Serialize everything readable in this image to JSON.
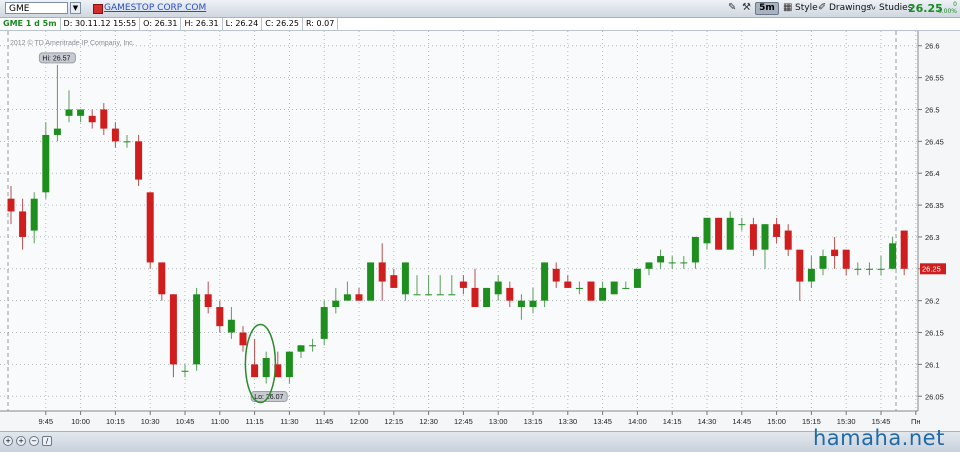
{
  "toolbar": {
    "symbol": "GME",
    "company_link": "GAMESTOP CORP COM",
    "period": "5m",
    "style_label": "Style",
    "drawings_label": "Drawings",
    "studies_label": "Studies",
    "last_price": "26.25",
    "change_abs": "0",
    "change_pct": "0.00%"
  },
  "info_bar": {
    "study": "GME 1 d 5m",
    "date": "D: 30.11.12 15:55",
    "open": "O: 26.31",
    "high": "H: 26.31",
    "low": "L: 26.24",
    "close": "C: 26.25",
    "range": "R: 0.07"
  },
  "chart_data": {
    "type": "candlestick",
    "copyright": "2012 © TD Ameritrade IP Company, Inc.",
    "high_label": "Hi: 26.57",
    "low_label": "Lo: 26.07",
    "price_label": "26.25",
    "ylim": [
      26.03,
      26.62
    ],
    "y_ticks": [
      "26.6",
      "26.55",
      "26.5",
      "26.45",
      "26.4",
      "26.35",
      "26.3",
      "26.25",
      "26.2",
      "26.15",
      "26.1",
      "26.05"
    ],
    "x_ticks": [
      "9:45",
      "10:00",
      "10:15",
      "10:30",
      "10:45",
      "11:00",
      "11:15",
      "11:30",
      "11:45",
      "12:00",
      "12:15",
      "12:30",
      "12:45",
      "13:00",
      "13:15",
      "13:30",
      "13:45",
      "14:00",
      "14:15",
      "14:30",
      "14:45",
      "15:00",
      "15:15",
      "15:30",
      "15:45",
      "Пн"
    ],
    "grid": true,
    "up_color": "#1e8f1e",
    "down_color": "#d01d1d",
    "candles": [
      {
        "o": 26.36,
        "h": 26.38,
        "l": 26.32,
        "c": 26.34
      },
      {
        "o": 26.34,
        "h": 26.36,
        "l": 26.28,
        "c": 26.3
      },
      {
        "o": 26.31,
        "h": 26.37,
        "l": 26.29,
        "c": 26.36
      },
      {
        "o": 26.37,
        "h": 26.48,
        "l": 26.36,
        "c": 26.46
      },
      {
        "o": 26.46,
        "h": 26.57,
        "l": 26.45,
        "c": 26.47
      },
      {
        "o": 26.49,
        "h": 26.53,
        "l": 26.48,
        "c": 26.5
      },
      {
        "o": 26.49,
        "h": 26.5,
        "l": 26.48,
        "c": 26.5
      },
      {
        "o": 26.49,
        "h": 26.5,
        "l": 26.47,
        "c": 26.48
      },
      {
        "o": 26.5,
        "h": 26.51,
        "l": 26.46,
        "c": 26.47
      },
      {
        "o": 26.47,
        "h": 26.48,
        "l": 26.44,
        "c": 26.45
      },
      {
        "o": 26.45,
        "h": 26.46,
        "l": 26.44,
        "c": 26.45
      },
      {
        "o": 26.45,
        "h": 26.46,
        "l": 26.38,
        "c": 26.39
      },
      {
        "o": 26.37,
        "h": 26.37,
        "l": 26.25,
        "c": 26.26
      },
      {
        "o": 26.26,
        "h": 26.26,
        "l": 26.2,
        "c": 26.21
      },
      {
        "o": 26.21,
        "h": 26.21,
        "l": 26.08,
        "c": 26.1
      },
      {
        "o": 26.09,
        "h": 26.1,
        "l": 26.08,
        "c": 26.09
      },
      {
        "o": 26.1,
        "h": 26.22,
        "l": 26.09,
        "c": 26.21
      },
      {
        "o": 26.21,
        "h": 26.23,
        "l": 26.18,
        "c": 26.19
      },
      {
        "o": 26.19,
        "h": 26.2,
        "l": 26.15,
        "c": 26.16
      },
      {
        "o": 26.15,
        "h": 26.19,
        "l": 26.14,
        "c": 26.17
      },
      {
        "o": 26.15,
        "h": 26.16,
        "l": 26.12,
        "c": 26.13
      },
      {
        "o": 26.1,
        "h": 26.14,
        "l": 26.08,
        "c": 26.08
      },
      {
        "o": 26.08,
        "h": 26.12,
        "l": 26.07,
        "c": 26.11
      },
      {
        "o": 26.1,
        "h": 26.12,
        "l": 26.08,
        "c": 26.08
      },
      {
        "o": 26.08,
        "h": 26.11,
        "l": 26.07,
        "c": 26.12
      },
      {
        "o": 26.12,
        "h": 26.13,
        "l": 26.11,
        "c": 26.13
      },
      {
        "o": 26.13,
        "h": 26.14,
        "l": 26.12,
        "c": 26.13
      },
      {
        "o": 26.14,
        "h": 26.2,
        "l": 26.13,
        "c": 26.19
      },
      {
        "o": 26.19,
        "h": 26.22,
        "l": 26.18,
        "c": 26.2
      },
      {
        "o": 26.2,
        "h": 26.23,
        "l": 26.2,
        "c": 26.21
      },
      {
        "o": 26.21,
        "h": 26.22,
        "l": 26.2,
        "c": 26.2
      },
      {
        "o": 26.2,
        "h": 26.26,
        "l": 26.2,
        "c": 26.26
      },
      {
        "o": 26.26,
        "h": 26.29,
        "l": 26.2,
        "c": 26.23
      },
      {
        "o": 26.24,
        "h": 26.25,
        "l": 26.22,
        "c": 26.22
      },
      {
        "o": 26.21,
        "h": 26.26,
        "l": 26.2,
        "c": 26.26
      },
      {
        "o": 26.21,
        "h": 26.24,
        "l": 26.21,
        "c": 26.21
      },
      {
        "o": 26.21,
        "h": 26.24,
        "l": 26.21,
        "c": 26.21
      },
      {
        "o": 26.21,
        "h": 26.24,
        "l": 26.21,
        "c": 26.21
      },
      {
        "o": 26.21,
        "h": 26.24,
        "l": 26.21,
        "c": 26.21
      },
      {
        "o": 26.23,
        "h": 26.24,
        "l": 26.21,
        "c": 26.22
      },
      {
        "o": 26.22,
        "h": 26.25,
        "l": 26.19,
        "c": 26.19
      },
      {
        "o": 26.19,
        "h": 26.22,
        "l": 26.19,
        "c": 26.22
      },
      {
        "o": 26.21,
        "h": 26.24,
        "l": 26.2,
        "c": 26.23
      },
      {
        "o": 26.22,
        "h": 26.23,
        "l": 26.19,
        "c": 26.2
      },
      {
        "o": 26.19,
        "h": 26.21,
        "l": 26.17,
        "c": 26.2
      },
      {
        "o": 26.19,
        "h": 26.22,
        "l": 26.18,
        "c": 26.2
      },
      {
        "o": 26.2,
        "h": 26.26,
        "l": 26.19,
        "c": 26.26
      },
      {
        "o": 26.25,
        "h": 26.26,
        "l": 26.22,
        "c": 26.23
      },
      {
        "o": 26.23,
        "h": 26.24,
        "l": 26.22,
        "c": 26.22
      },
      {
        "o": 26.22,
        "h": 26.23,
        "l": 26.21,
        "c": 26.22
      },
      {
        "o": 26.23,
        "h": 26.23,
        "l": 26.2,
        "c": 26.2
      },
      {
        "o": 26.2,
        "h": 26.23,
        "l": 26.2,
        "c": 26.22
      },
      {
        "o": 26.21,
        "h": 26.23,
        "l": 26.21,
        "c": 26.23
      },
      {
        "o": 26.22,
        "h": 26.23,
        "l": 26.22,
        "c": 26.22
      },
      {
        "o": 26.22,
        "h": 26.25,
        "l": 26.22,
        "c": 26.25
      },
      {
        "o": 26.25,
        "h": 26.26,
        "l": 26.24,
        "c": 26.26
      },
      {
        "o": 26.26,
        "h": 26.28,
        "l": 26.25,
        "c": 26.27
      },
      {
        "o": 26.26,
        "h": 26.27,
        "l": 26.25,
        "c": 26.26
      },
      {
        "o": 26.26,
        "h": 26.27,
        "l": 26.25,
        "c": 26.26
      },
      {
        "o": 26.26,
        "h": 26.3,
        "l": 26.25,
        "c": 26.3
      },
      {
        "o": 26.29,
        "h": 26.33,
        "l": 26.28,
        "c": 26.33
      },
      {
        "o": 26.33,
        "h": 26.33,
        "l": 26.28,
        "c": 26.28
      },
      {
        "o": 26.28,
        "h": 26.34,
        "l": 26.28,
        "c": 26.33
      },
      {
        "o": 26.32,
        "h": 26.33,
        "l": 26.31,
        "c": 26.32
      },
      {
        "o": 26.32,
        "h": 26.33,
        "l": 26.27,
        "c": 26.28
      },
      {
        "o": 26.28,
        "h": 26.32,
        "l": 26.25,
        "c": 26.32
      },
      {
        "o": 26.32,
        "h": 26.33,
        "l": 26.29,
        "c": 26.3
      },
      {
        "o": 26.31,
        "h": 26.32,
        "l": 26.27,
        "c": 26.28
      },
      {
        "o": 26.28,
        "h": 26.28,
        "l": 26.2,
        "c": 26.23
      },
      {
        "o": 26.23,
        "h": 26.27,
        "l": 26.22,
        "c": 26.25
      },
      {
        "o": 26.25,
        "h": 26.28,
        "l": 26.24,
        "c": 26.27
      },
      {
        "o": 26.28,
        "h": 26.3,
        "l": 26.25,
        "c": 26.27
      },
      {
        "o": 26.28,
        "h": 26.28,
        "l": 26.24,
        "c": 26.25
      },
      {
        "o": 26.25,
        "h": 26.26,
        "l": 26.24,
        "c": 26.25
      },
      {
        "o": 26.25,
        "h": 26.26,
        "l": 26.24,
        "c": 26.25
      },
      {
        "o": 26.25,
        "h": 26.27,
        "l": 26.24,
        "c": 26.25
      },
      {
        "o": 26.25,
        "h": 26.3,
        "l": 26.25,
        "c": 26.29
      },
      {
        "o": 26.31,
        "h": 26.31,
        "l": 26.24,
        "c": 26.25
      }
    ]
  },
  "watermark": "hamaha.net"
}
